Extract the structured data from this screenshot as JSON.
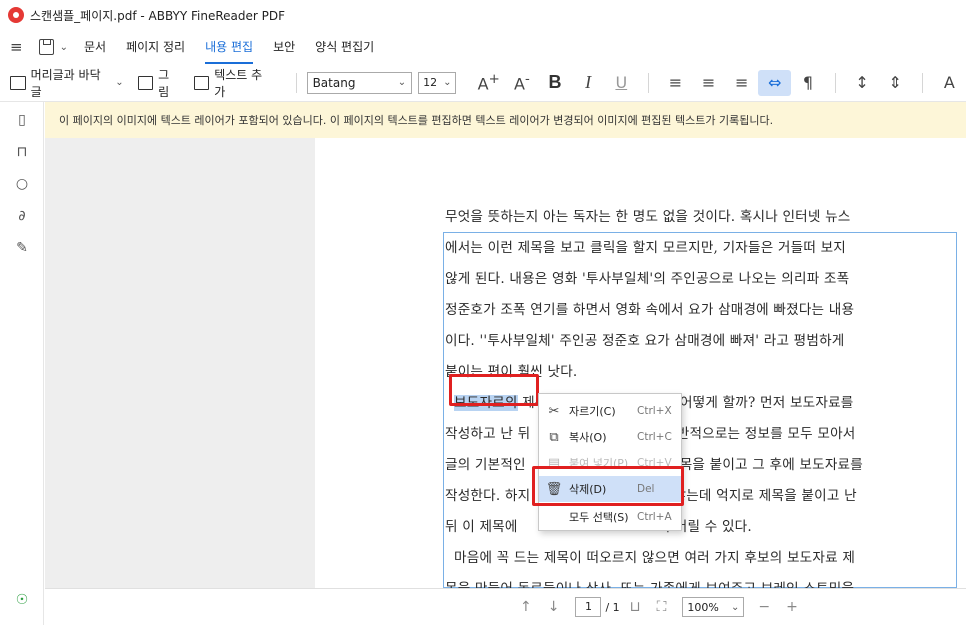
{
  "window": {
    "title": "스캔샘플_페이지.pdf - ABBYY FineReader PDF"
  },
  "menu": {
    "items": [
      "문서",
      "페이지 정리",
      "내용 편집",
      "보안",
      "양식 편집기"
    ]
  },
  "toolbar": {
    "header_footer": "머리글과 바닥글",
    "picture": "그림",
    "add_text": "텍스트 추가",
    "font": "Batang",
    "size": "12"
  },
  "info_bar": "이 페이지의 이미지에 텍스트 레이어가 포함되어 있습니다. 이 페이지의 텍스트를 편집하면 텍스트 레이어가 변경되어 이미지에 편집된 텍스트가 기록됩니다.",
  "document": {
    "lines": [
      "무엇을 뜻하는지 아는 독자는 한 명도 없을 것이다. 혹시나 인터넷 뉴스",
      "에서는 이런 제목을 보고 클릭을 할지 모르지만, 기자들은 거들떠 보지",
      "않게 된다. 내용은 영화 '투사부일체'의 주인공으로 나오는 의리파 조폭",
      "정준호가 조폭 연기를 하면서 영화 속에서 요가 삼매경에 빠졌다는 내용",
      "이다. ''투사부일체' 주인공 정준호 요가 삼매경에 빠져' 라고 평범하게",
      "붙이는 편이 훨씬 낫다.",
      "제목이 잘 떠오르지 않으면 어떻게 할까? 먼저 보도자료를",
      "작성하고 난 뒤",
      "다. 일반적으로는 정보를 모두 모아서",
      "글의 기본적인",
      "뒤 제목을 붙이고 그 후에 보도자료를",
      "작성한다. 하지",
      "지 않는데 억지로 제목을 붙이고 난",
      "뒤 이 제목에",
      "여 버릴 수 있다.",
      "마음에 꼭 드는 제목이 떠오르지 않으면 여러 가지 후보의 보도자료 제",
      "목을 만들어 동료들이나 상사, 또는 가족에게 보여주고 브레인 스토밍을"
    ],
    "selected_word": "보도자료의"
  },
  "context_menu": [
    {
      "label": "자르기(C)",
      "shortcut": "Ctrl+X",
      "icon": "scissors-icon",
      "enabled": true
    },
    {
      "label": "복사(O)",
      "shortcut": "Ctrl+C",
      "icon": "copy-icon",
      "enabled": true
    },
    {
      "label": "붙여 넣기(P)",
      "shortcut": "Ctrl+V",
      "icon": "paste-icon",
      "enabled": false
    },
    {
      "label": "삭제(D)",
      "shortcut": "Del",
      "icon": "trash-icon",
      "enabled": true
    },
    {
      "label": "모두 선택(S)",
      "shortcut": "Ctrl+A",
      "icon": "",
      "enabled": true
    }
  ],
  "status": {
    "page": "1",
    "total": "/ 1",
    "zoom": "100%"
  }
}
